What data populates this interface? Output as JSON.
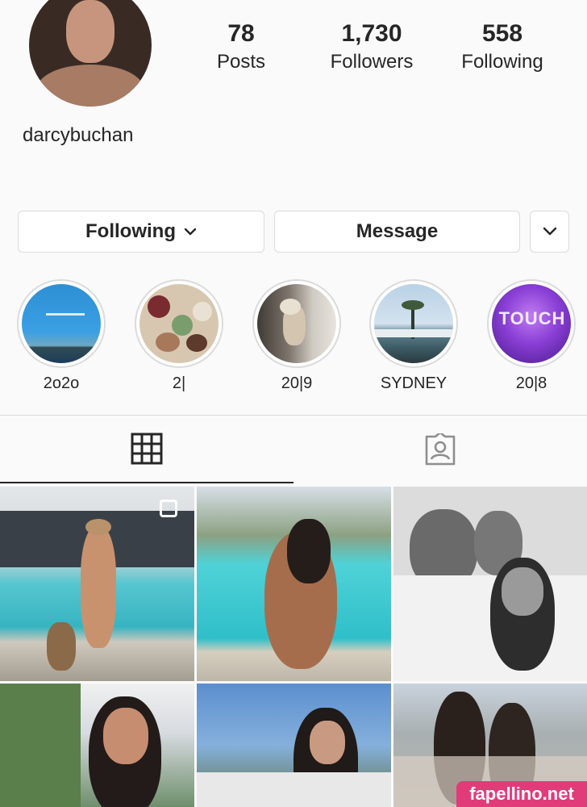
{
  "profile": {
    "username": "darcybuchan",
    "stats": [
      {
        "value": "78",
        "label": "Posts"
      },
      {
        "value": "1,730",
        "label": "Followers"
      },
      {
        "value": "558",
        "label": "Following"
      }
    ]
  },
  "actions": {
    "following_label": "Following",
    "message_label": "Message",
    "more_icon": "chevron-down-icon"
  },
  "highlights": [
    {
      "label": "2o2o"
    },
    {
      "label": "2|"
    },
    {
      "label": "20|9"
    },
    {
      "label": "SYDNEY"
    },
    {
      "label": "20|8",
      "inner_text": "TOUCH"
    }
  ],
  "tabs": [
    {
      "icon": "grid-icon",
      "active": true
    },
    {
      "icon": "tagged-icon",
      "active": false
    }
  ],
  "colors": {
    "accent_watermark": "#e23b7a",
    "border": "#dbdbdb",
    "text": "#262626"
  },
  "watermark": "fapellino.net"
}
